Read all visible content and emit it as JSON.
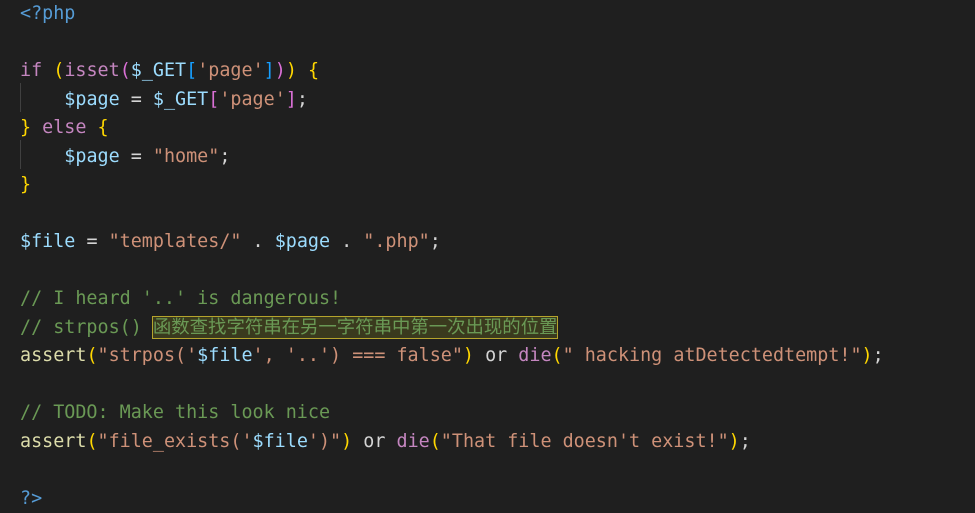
{
  "editor": {
    "colors": {
      "background": "#1f1f1f",
      "keyword": "#c586c0",
      "tag": "#569cd6",
      "variable": "#9cdcfe",
      "string": "#ce9178",
      "function": "#dcdcaa",
      "comment": "#6a9955",
      "bracket_level1": "#ffd700",
      "bracket_level2": "#da70d6",
      "bracket_level3": "#179fff",
      "highlight_border": "#b5a42c"
    },
    "lines": [
      {
        "tokens": [
          {
            "t": "<?php",
            "c": "t-tag"
          }
        ]
      },
      {
        "tokens": []
      },
      {
        "tokens": [
          {
            "t": "if",
            "c": "t-kw"
          },
          {
            "t": " ",
            "c": "t-plain"
          },
          {
            "t": "(",
            "c": "t-b1"
          },
          {
            "t": "isset",
            "c": "t-kw"
          },
          {
            "t": "(",
            "c": "t-b2"
          },
          {
            "t": "$_GET",
            "c": "t-var"
          },
          {
            "t": "[",
            "c": "t-b3"
          },
          {
            "t": "'page'",
            "c": "t-str"
          },
          {
            "t": "]",
            "c": "t-b3"
          },
          {
            "t": ")",
            "c": "t-b2"
          },
          {
            "t": ")",
            "c": "t-b1"
          },
          {
            "t": " ",
            "c": "t-plain"
          },
          {
            "t": "{",
            "c": "t-b1"
          }
        ]
      },
      {
        "tokens": [
          {
            "t": "    ",
            "c": "t-plain"
          },
          {
            "t": "$page",
            "c": "t-var"
          },
          {
            "t": " = ",
            "c": "t-plain"
          },
          {
            "t": "$_GET",
            "c": "t-var"
          },
          {
            "t": "[",
            "c": "t-b2"
          },
          {
            "t": "'page'",
            "c": "t-str"
          },
          {
            "t": "]",
            "c": "t-b2"
          },
          {
            "t": ";",
            "c": "t-plain"
          }
        ]
      },
      {
        "tokens": [
          {
            "t": "}",
            "c": "t-b1"
          },
          {
            "t": " ",
            "c": "t-plain"
          },
          {
            "t": "else",
            "c": "t-kw"
          },
          {
            "t": " ",
            "c": "t-plain"
          },
          {
            "t": "{",
            "c": "t-b1"
          }
        ]
      },
      {
        "tokens": [
          {
            "t": "    ",
            "c": "t-plain"
          },
          {
            "t": "$page",
            "c": "t-var"
          },
          {
            "t": " = ",
            "c": "t-plain"
          },
          {
            "t": "\"home\"",
            "c": "t-str"
          },
          {
            "t": ";",
            "c": "t-plain"
          }
        ]
      },
      {
        "tokens": [
          {
            "t": "}",
            "c": "t-b1"
          }
        ]
      },
      {
        "tokens": []
      },
      {
        "tokens": [
          {
            "t": "$file",
            "c": "t-var"
          },
          {
            "t": " = ",
            "c": "t-plain"
          },
          {
            "t": "\"templates/\"",
            "c": "t-str"
          },
          {
            "t": " . ",
            "c": "t-plain"
          },
          {
            "t": "$page",
            "c": "t-var"
          },
          {
            "t": " . ",
            "c": "t-plain"
          },
          {
            "t": "\".php\"",
            "c": "t-str"
          },
          {
            "t": ";",
            "c": "t-plain"
          }
        ]
      },
      {
        "tokens": []
      },
      {
        "tokens": [
          {
            "t": "// I heard '..' is dangerous!",
            "c": "t-cm"
          }
        ]
      },
      {
        "tokens": [
          {
            "t": "// strpos() ",
            "c": "t-cm"
          },
          {
            "t": "函数查找字符串在另一字符串中第一次出现的位置",
            "c": "t-cjk highlight"
          }
        ]
      },
      {
        "tokens": [
          {
            "t": "assert",
            "c": "t-fn"
          },
          {
            "t": "(",
            "c": "t-b1"
          },
          {
            "t": "\"strpos('",
            "c": "t-str"
          },
          {
            "t": "$file",
            "c": "t-var"
          },
          {
            "t": "', '..') === false\"",
            "c": "t-str"
          },
          {
            "t": ")",
            "c": "t-b1"
          },
          {
            "t": " or ",
            "c": "t-plain"
          },
          {
            "t": "die",
            "c": "t-kw"
          },
          {
            "t": "(",
            "c": "t-b1"
          },
          {
            "t": "\" hacking atDetectedtempt!\"",
            "c": "t-str"
          },
          {
            "t": ")",
            "c": "t-b1"
          },
          {
            "t": ";",
            "c": "t-plain"
          }
        ]
      },
      {
        "tokens": []
      },
      {
        "tokens": [
          {
            "t": "// TODO: Make this look nice",
            "c": "t-cm"
          }
        ]
      },
      {
        "tokens": [
          {
            "t": "assert",
            "c": "t-fn"
          },
          {
            "t": "(",
            "c": "t-b1"
          },
          {
            "t": "\"file_exists('",
            "c": "t-str"
          },
          {
            "t": "$file",
            "c": "t-var"
          },
          {
            "t": "')\"",
            "c": "t-str"
          },
          {
            "t": ")",
            "c": "t-b1"
          },
          {
            "t": " or ",
            "c": "t-plain"
          },
          {
            "t": "die",
            "c": "t-kw"
          },
          {
            "t": "(",
            "c": "t-b1"
          },
          {
            "t": "\"That file doesn't exist!\"",
            "c": "t-str"
          },
          {
            "t": ")",
            "c": "t-b1"
          },
          {
            "t": ";",
            "c": "t-plain"
          }
        ]
      },
      {
        "tokens": []
      },
      {
        "tokens": [
          {
            "t": "?>",
            "c": "t-tag"
          }
        ]
      }
    ]
  }
}
